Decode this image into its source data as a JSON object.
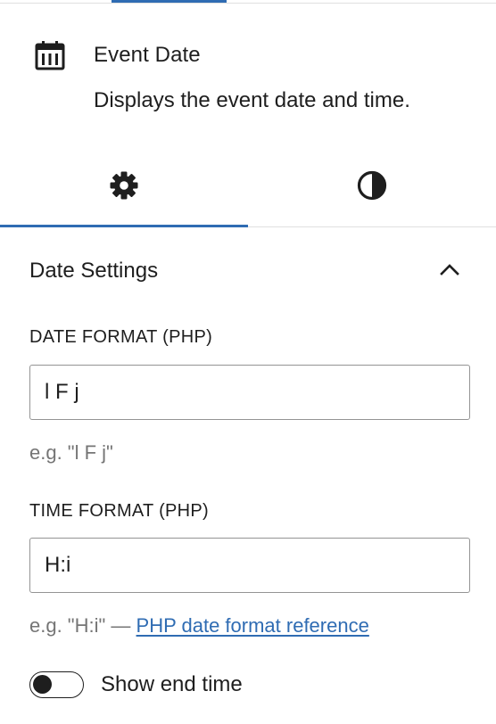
{
  "colors": {
    "accent": "#2f6cb3",
    "text": "#1e1e1e",
    "muted": "#757575",
    "border": "#949494",
    "divider": "#e0e0e0"
  },
  "block_card": {
    "icon": "calendar-icon",
    "title": "Event Date",
    "description": "Displays the event date and time."
  },
  "inspector_tabs": [
    {
      "icon": "gear-icon",
      "label": "Settings",
      "active": true
    },
    {
      "icon": "contrast-icon",
      "label": "Styles",
      "active": false
    }
  ],
  "panel": {
    "title": "Date Settings",
    "expanded": true,
    "toggle_icon": "chevron-up-icon"
  },
  "date_format": {
    "label": "DATE FORMAT (PHP)",
    "value": "l F j",
    "help": "e.g. \"l F j\""
  },
  "time_format": {
    "label": "TIME FORMAT (PHP)",
    "value": "H:i",
    "help_prefix": "e.g. \"H:i\" — ",
    "help_link": "PHP date format reference"
  },
  "show_end_time": {
    "label": "Show end time",
    "checked": false
  }
}
